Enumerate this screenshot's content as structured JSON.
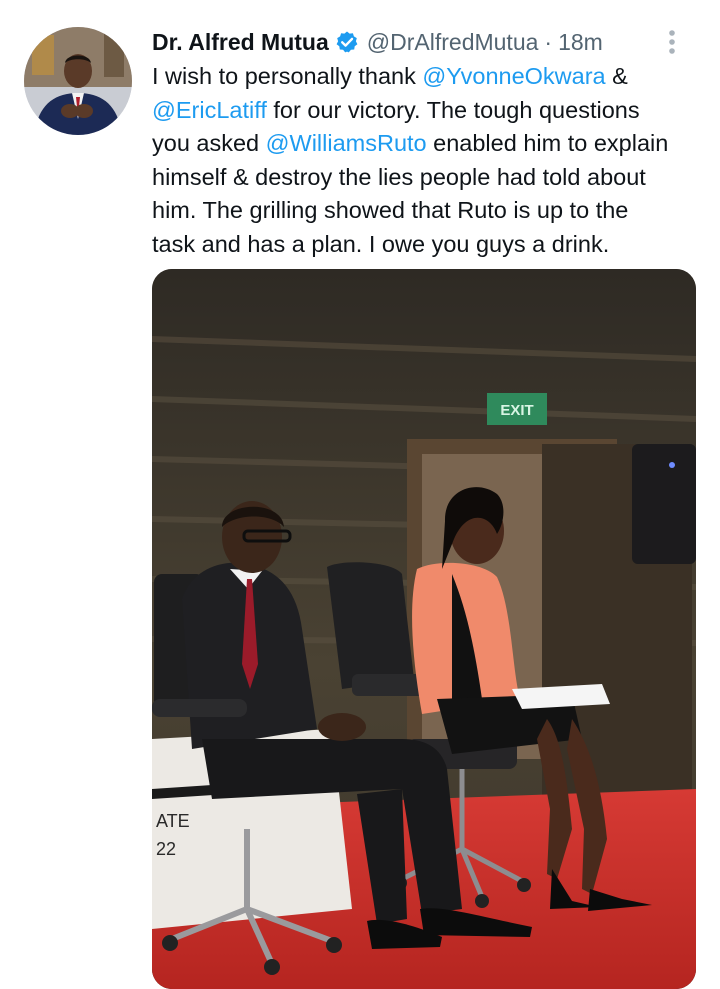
{
  "tweet": {
    "author_name": "Dr. Alfred Mutua",
    "handle": "@DrAlfredMutua",
    "separator": "·",
    "time": "18m",
    "text_lines": [
      [
        {
          "t": "I wish to personally thank "
        },
        {
          "t": "@YvonneOkwara",
          "m": true
        },
        {
          "t": " &"
        }
      ],
      [
        {
          "t": "@EricLatiff",
          "m": true
        },
        {
          "t": " for our victory. The tough questions"
        }
      ],
      [
        {
          "t": "you asked "
        },
        {
          "t": "@WilliamsRuto",
          "m": true
        },
        {
          "t": " enabled him to explain"
        }
      ],
      [
        {
          "t": "himself & destroy the lies people had told about"
        }
      ],
      [
        {
          "t": "him. The grilling showed that Ruto is up to the"
        }
      ],
      [
        {
          "t": "task and has a plan. I owe you guys a drink."
        }
      ]
    ],
    "icons": {
      "verified": "verified-badge-icon",
      "more": "more-options-icon"
    },
    "colors": {
      "text": "#0f1419",
      "secondary": "#536471",
      "mention": "#1d9bf0",
      "verified": "#1d9bf0"
    }
  },
  "photo": {
    "exit_sign": "EXIT",
    "set_text_top": "ATE",
    "set_text_bottom": "22"
  }
}
